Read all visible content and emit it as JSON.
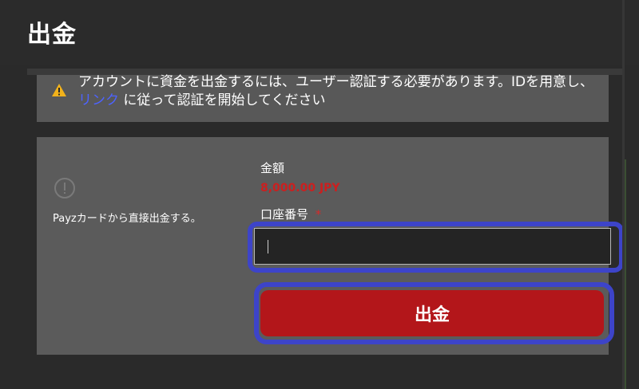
{
  "page": {
    "title": "出金"
  },
  "warning": {
    "text_before": "アカウントに資金を出金するには、ユーザー認証する必要があります。IDを用意し、",
    "link_text": "リンク",
    "text_after": "に従って認証を開始してください",
    "icon": "warning-icon"
  },
  "method": {
    "description": "Payzカードから直接出金する。",
    "icon": "info-icon"
  },
  "amount": {
    "label": "金額",
    "value": "8,000.00 JPY"
  },
  "account": {
    "label": "口座番号",
    "required": "*",
    "value": "",
    "placeholder": ""
  },
  "actions": {
    "submit_label": "出金"
  },
  "colors": {
    "background": "#2a2a2a",
    "warning_panel": "#585858",
    "card": "#5b5b5b",
    "amount_red": "#cc1f1f",
    "link_blue": "#4d63ff",
    "button_red": "#b3161a",
    "highlight_blue": "#3d44c9"
  }
}
